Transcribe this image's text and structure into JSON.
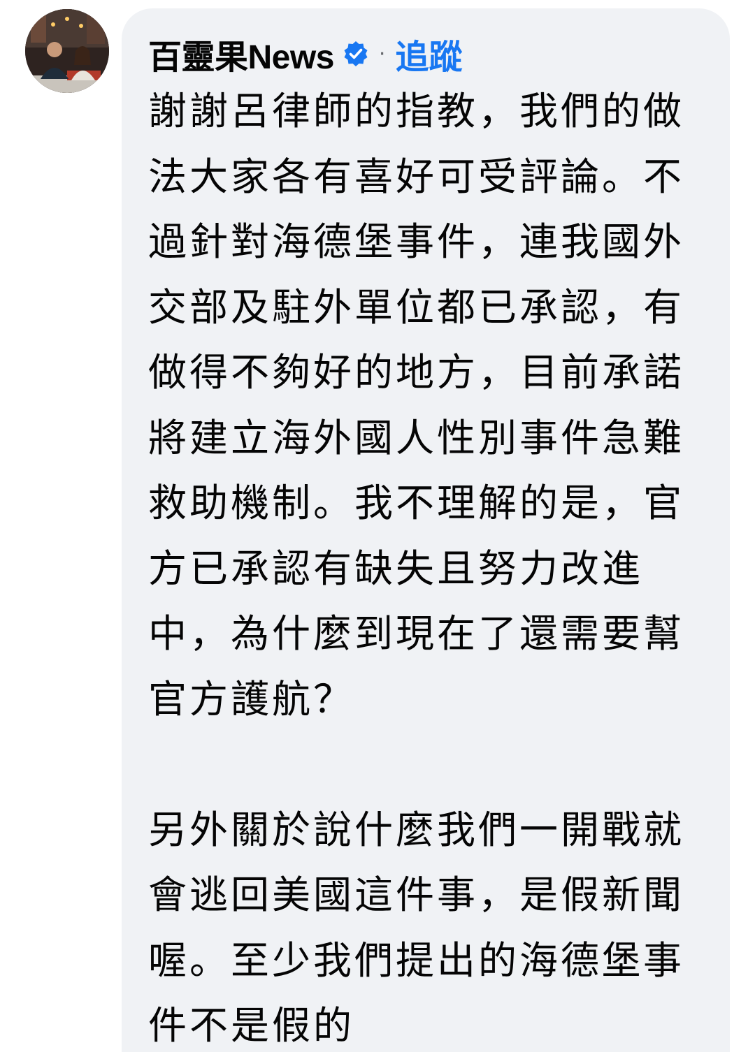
{
  "comment": {
    "author": "百靈果News",
    "verified_icon": "verified-badge-icon",
    "separator": "·",
    "follow_label": "追蹤",
    "colors": {
      "bubble": "#f0f2f5",
      "follow": "#1877f2",
      "verified": "#1877f2",
      "text": "#050505"
    },
    "paragraph1_lines": [
      "謝謝呂律師的指教，我們的做",
      "法大家各有喜好可受評論。不",
      "過針對海德堡事件，連我國外",
      "交部及駐外單位都已承認，有",
      "做得不夠好的地方，目前承諾",
      "將建立海外國人性別事件急難",
      "救助機制。我不理解的是，官",
      "方已承認有缺失且努力改進",
      "中，為什麼到現在了還需要幫",
      "官方護航？"
    ],
    "paragraph2_lines": [
      "另外關於說什麼我們一開戰就",
      "會逃回美國這件事，是假新聞",
      "喔。至少我們提出的海德堡事",
      "件不是假的"
    ]
  }
}
